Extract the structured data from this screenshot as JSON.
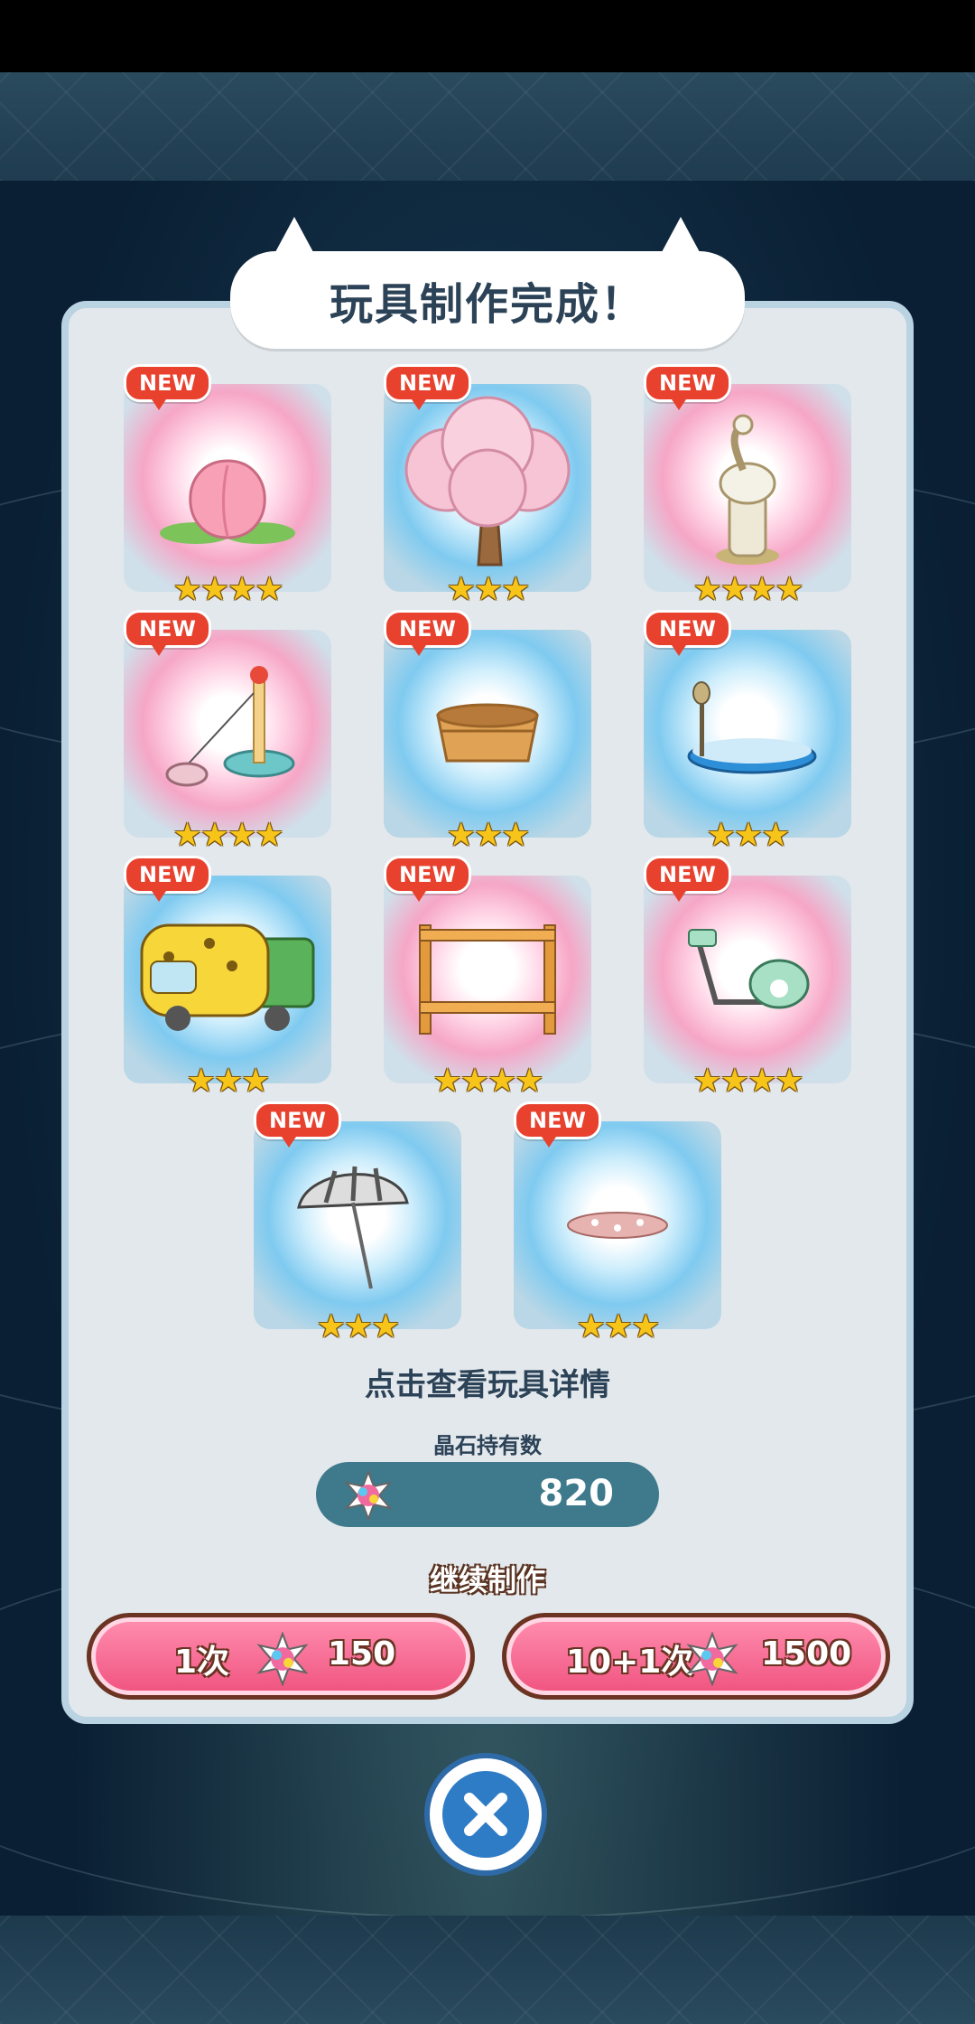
{
  "title": "玩具制作完成！",
  "toys": [
    {
      "new_label": "NEW",
      "stars": "★★★★",
      "glow": "pink",
      "icon": "peach-icon"
    },
    {
      "new_label": "NEW",
      "stars": "★★★",
      "glow": "blue",
      "icon": "cherry-tree-icon"
    },
    {
      "new_label": "NEW",
      "stars": "★★★★",
      "glow": "pink",
      "icon": "goose-statue-icon"
    },
    {
      "new_label": "NEW",
      "stars": "★★★★",
      "glow": "pink",
      "icon": "cat-teaser-pole-icon"
    },
    {
      "new_label": "NEW",
      "stars": "★★★",
      "glow": "blue",
      "icon": "wooden-tub-icon"
    },
    {
      "new_label": "NEW",
      "stars": "★★★",
      "glow": "blue",
      "icon": "microphone-stage-icon"
    },
    {
      "new_label": "NEW",
      "stars": "★★★",
      "glow": "blue",
      "icon": "leopard-bus-icon"
    },
    {
      "new_label": "NEW",
      "stars": "★★★★",
      "glow": "pink",
      "icon": "wooden-shelf-icon"
    },
    {
      "new_label": "NEW",
      "stars": "★★★★",
      "glow": "pink",
      "icon": "exercise-bike-icon"
    },
    {
      "new_label": "NEW",
      "stars": "★★★",
      "glow": "blue",
      "icon": "parasol-icon"
    },
    {
      "new_label": "NEW",
      "stars": "★★★",
      "glow": "blue",
      "icon": "petal-mat-icon"
    }
  ],
  "hint": "点击查看玩具详情",
  "gem_label": "晶石持有数",
  "gem_count": "820",
  "continue_label": "继续制作",
  "buttons": [
    {
      "label": "1次",
      "cost": "150"
    },
    {
      "label": "10+1次",
      "cost": "1500"
    }
  ],
  "colors": {
    "accent": "#f0527f",
    "panel": "#e3e8ec",
    "text": "#2c4257",
    "close": "#2f7cc6"
  }
}
